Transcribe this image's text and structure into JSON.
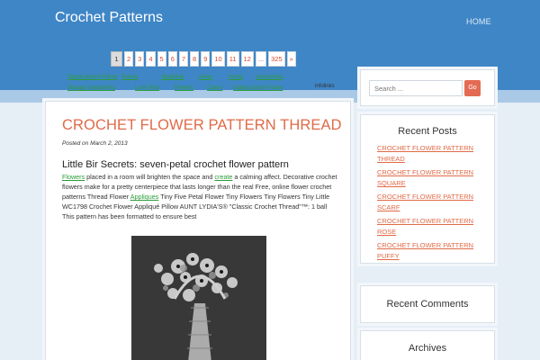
{
  "header": {
    "site_title": "Crochet Patterns",
    "home_link": "HOME"
  },
  "pagination": {
    "pages": [
      "1",
      "2",
      "3",
      "4",
      "5",
      "6",
      "7",
      "8",
      "9",
      "10",
      "11",
      "12",
      "...",
      "325",
      "»"
    ],
    "current": "1"
  },
  "linkbar": {
    "row1": [
      "Digital picture Frame",
      "Events",
      "Sparkling",
      "Asian",
      "Home",
      "Instructions"
    ],
    "row2": [
      "Vintage Sweatshirts",
      "Love Tees",
      "Flowers",
      "Colors",
      "Digital picture Frame"
    ],
    "infolinks": "infolinks"
  },
  "post": {
    "title": "CROCHET FLOWER PATTERN THREAD",
    "date": "Posted on March 2, 2013",
    "subheading": "Little Bir Secrets: seven-petal crochet flower pattern",
    "body": {
      "link1": "Flowers",
      "text1": " placed in a room will brighten the space and ",
      "link2": "create",
      "text2": " a calming affect. Decorative crochet flowers make for a pretty centerpiece that lasts longer than the real Free, online flower crochet patterns Thread Flower ",
      "link3": "Appliques",
      "text3": " Tiny Five Petal Flower Tiny Flowers Tiny Flowers Tiny Little WC1798 Crochet Flower Appliqué Pillow AUNT LYDIA'S® \"Classic Crochet Thread\"™: 1 ball This pattern has been formatted to ensure best"
    }
  },
  "sidebar": {
    "search": {
      "placeholder": "Search ...",
      "button_label": "Go"
    },
    "recent_posts": {
      "title": "Recent Posts",
      "items": [
        "CROCHET FLOWER PATTERN THREAD",
        "CROCHET FLOWER PATTERN SQUARE",
        "CROCHET FLOWER PATTERN SCARF",
        "CROCHET FLOWER PATTERN ROSE",
        "CROCHET FLOWER PATTERN PUFFY"
      ]
    },
    "recent_comments": {
      "title": "Recent Comments"
    },
    "archives": {
      "title": "Archives"
    }
  },
  "colors": {
    "header_blue": "#3f86c6",
    "accent_orange": "#e06a47",
    "link_green": "#2b9d3a"
  }
}
